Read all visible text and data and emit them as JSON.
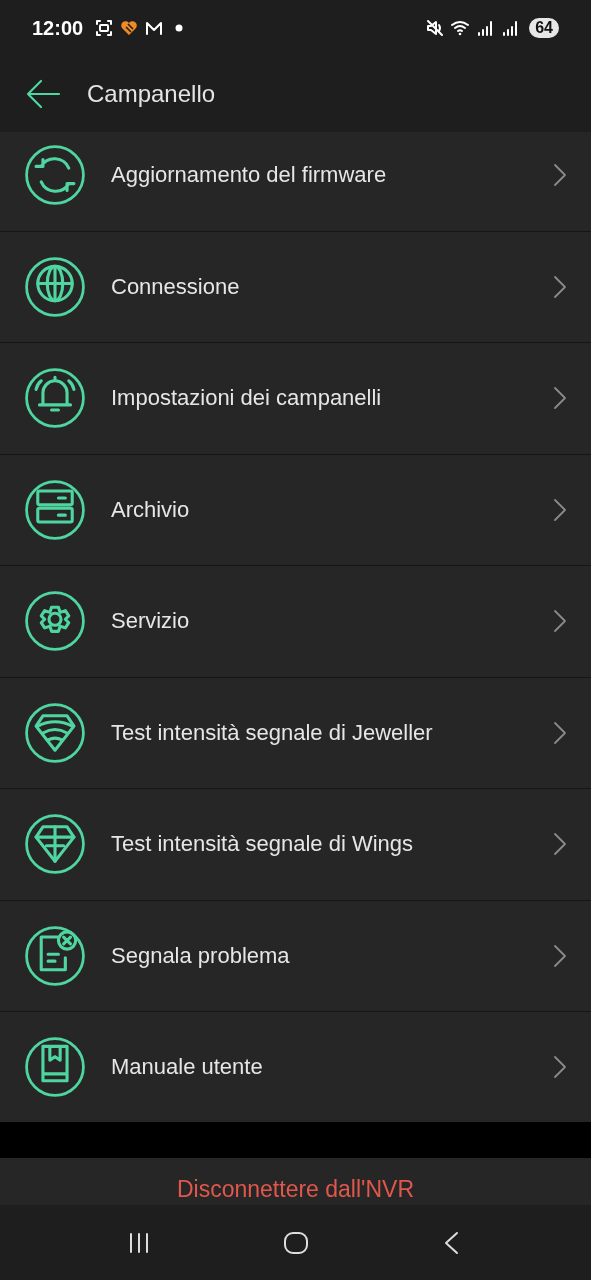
{
  "status_bar": {
    "time": "12:00",
    "left_icons": [
      {
        "kind": "screenshot"
      },
      {
        "kind": "heart"
      },
      {
        "kind": "mail"
      },
      {
        "kind": "dot"
      }
    ],
    "right_icons": [
      {
        "kind": "mute"
      },
      {
        "kind": "wifi"
      },
      {
        "kind": "signal"
      },
      {
        "kind": "signal"
      }
    ],
    "battery": "64"
  },
  "header": {
    "title": "Campanello"
  },
  "items": [
    {
      "kind": "refresh",
      "label": "Aggiornamento del firmware"
    },
    {
      "kind": "globe",
      "label": "Connessione"
    },
    {
      "kind": "bell",
      "label": "Impostazioni dei campanelli"
    },
    {
      "kind": "storage",
      "label": "Archivio"
    },
    {
      "kind": "gear",
      "label": "Servizio"
    },
    {
      "kind": "signal-gem",
      "label": "Test intensità segnale di Jeweller"
    },
    {
      "kind": "gem",
      "label": "Test intensità segnale di Wings"
    },
    {
      "kind": "report",
      "label": "Segnala problema"
    },
    {
      "kind": "book",
      "label": "Manuale utente"
    }
  ],
  "disconnect_button": "Disconnettere dall'NVR",
  "nav_bar": [
    {
      "kind": "recents"
    },
    {
      "kind": "home"
    },
    {
      "kind": "back"
    }
  ]
}
